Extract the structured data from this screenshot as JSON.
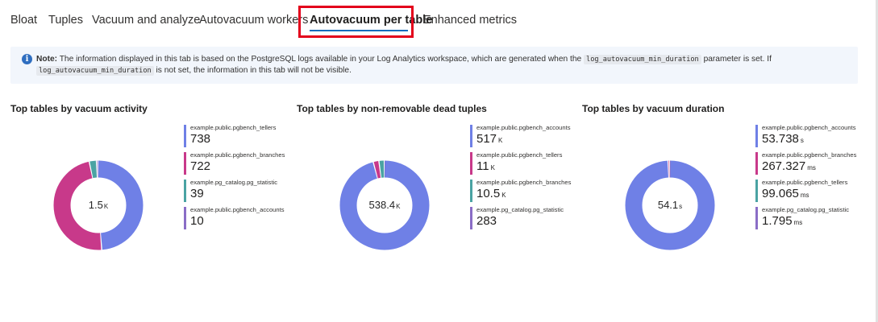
{
  "tabs": [
    {
      "label": "Bloat",
      "active": false
    },
    {
      "label": "Tuples",
      "active": false
    },
    {
      "label": "Vacuum and analyze",
      "active": false
    },
    {
      "label": "Autovacuum workers",
      "active": false
    },
    {
      "label": "Autovacuum per table",
      "active": true
    },
    {
      "label": "Enhanced metrics",
      "active": false
    }
  ],
  "info": {
    "icon": "info-icon",
    "note_label": "Note:",
    "text_1": "The information displayed in this tab is based on the PostgreSQL logs available in your Log Analytics workspace, which are generated when the",
    "code_1": "log_autovacuum_min_duration",
    "text_2": "parameter is set. If",
    "code_2": "log_autovacuum_min_duration",
    "text_3": "is not set, the information in this tab will not be visible."
  },
  "colors": {
    "blue": "#6f80e6",
    "magenta": "#c8398a",
    "teal": "#4aa3a3",
    "purple": "#8a6dc6",
    "highlight": "#e3001b",
    "accent": "#0f6cbd"
  },
  "chart_data": [
    {
      "type": "pie",
      "title": "Top tables by vacuum activity",
      "center_value": "1.5",
      "center_unit": "K",
      "series": [
        {
          "name": "example.public.pgbench_tellers",
          "value": 738,
          "display": "738",
          "unit": "",
          "color": "#6f80e6"
        },
        {
          "name": "example.public.pgbench_branches",
          "value": 722,
          "display": "722",
          "unit": "",
          "color": "#c8398a"
        },
        {
          "name": "example.pg_catalog.pg_statistic",
          "value": 39,
          "display": "39",
          "unit": "",
          "color": "#4aa3a3"
        },
        {
          "name": "example.public.pgbench_accounts",
          "value": 10,
          "display": "10",
          "unit": "",
          "color": "#8a6dc6"
        }
      ]
    },
    {
      "type": "pie",
      "title": "Top tables by non-removable dead tuples",
      "center_value": "538.4",
      "center_unit": "K",
      "series": [
        {
          "name": "example.public.pgbench_accounts",
          "value": 517000,
          "display": "517",
          "unit": "K",
          "color": "#6f80e6"
        },
        {
          "name": "example.public.pgbench_tellers",
          "value": 11000,
          "display": "11",
          "unit": "K",
          "color": "#c8398a"
        },
        {
          "name": "example.public.pgbench_branches",
          "value": 10500,
          "display": "10.5",
          "unit": "K",
          "color": "#4aa3a3"
        },
        {
          "name": "example.pg_catalog.pg_statistic",
          "value": 283,
          "display": "283",
          "unit": "",
          "color": "#8a6dc6"
        }
      ]
    },
    {
      "type": "pie",
      "title": "Top tables by vacuum duration",
      "center_value": "54.1",
      "center_unit": "s",
      "series": [
        {
          "name": "example.public.pgbench_accounts",
          "value": 53.738,
          "display": "53.738",
          "unit": "s",
          "color": "#6f80e6"
        },
        {
          "name": "example.public.pgbench_branches",
          "value": 0.267327,
          "display": "267.327",
          "unit": "ms",
          "color": "#c8398a"
        },
        {
          "name": "example.public.pgbench_tellers",
          "value": 0.099065,
          "display": "99.065",
          "unit": "ms",
          "color": "#4aa3a3"
        },
        {
          "name": "example.pg_catalog.pg_statistic",
          "value": 0.001795,
          "display": "1.795",
          "unit": "ms",
          "color": "#8a6dc6"
        }
      ]
    }
  ]
}
